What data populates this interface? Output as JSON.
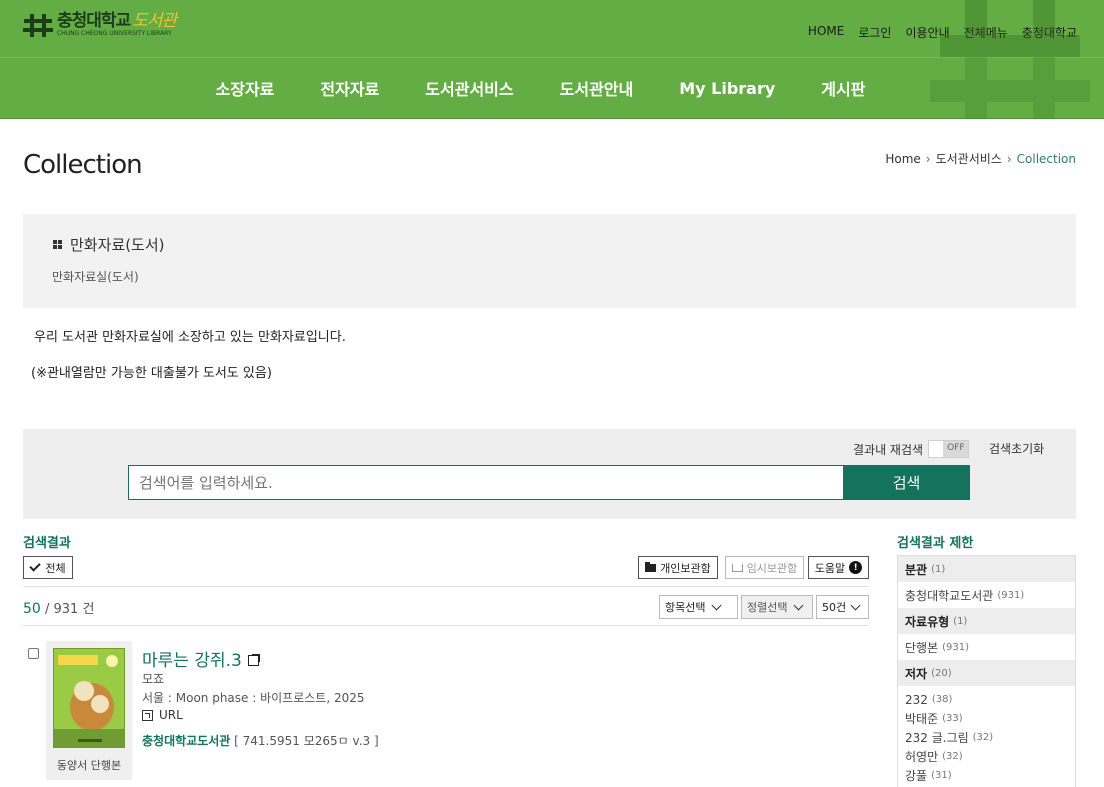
{
  "header": {
    "logo_kor": "충청대학교",
    "logo_lib": "도서관",
    "logo_eng": "CHUNG CHEONG UNIVERSITY LIBRARY",
    "util_links": [
      "HOME",
      "로그인",
      "이용안내",
      "전체메뉴",
      "충청대학교"
    ],
    "gnb": [
      "소장자료",
      "전자자료",
      "도서관서비스",
      "도서관안내",
      "My Library",
      "게시판"
    ]
  },
  "page": {
    "title": "Collection",
    "breadcrumb": [
      "Home",
      "도서관서비스",
      "Collection"
    ]
  },
  "info": {
    "title": "만화자료(도서)",
    "subtitle": "만화자료실(도서)",
    "desc1": "우리 도서관 만화자료실에 소장하고 있는 만화자료입니다.",
    "desc2": "(※관내열람만 가능한 대출불가 도서도 있음)"
  },
  "search": {
    "re_search_label": "결과내 재검색",
    "toggle_label": "OFF",
    "reset_label": "검색초기화",
    "placeholder": "검색어를 입력하세요.",
    "button": "검색"
  },
  "results": {
    "label": "검색결과",
    "all_button": "전체",
    "personal_button": "개인보관함",
    "temp_button": "임시보관함",
    "help_button": "도움말",
    "help_mark": "!",
    "count_shown": "50",
    "count_sep": "/",
    "count_total": "931 건",
    "select_items": "항목선택",
    "select_sort": "정렬선택",
    "select_per_page": "50건"
  },
  "items": [
    {
      "title": "마루는 강쥐.3",
      "author": "모죠",
      "publication": "서울 : Moon phase : 바이프로스트, 2025",
      "url_label": "URL",
      "library": "충청대학교도서관",
      "call_number": "[ 741.5951 모265ㅁ v.3 ]",
      "type": "동양서 단행본"
    }
  ],
  "facets": {
    "title": "검색결과 제한",
    "groups": [
      {
        "name": "분관",
        "count": "(1)",
        "values": [
          {
            "label": "충청대학교도서관",
            "count": "(931)"
          }
        ]
      },
      {
        "name": "자료유형",
        "count": "(1)",
        "values": [
          {
            "label": "단행본",
            "count": "(931)"
          }
        ]
      },
      {
        "name": "저자",
        "count": "(20)",
        "values": [
          {
            "label": "232",
            "count": "(38)"
          },
          {
            "label": "박태준",
            "count": "(33)"
          },
          {
            "label": "232 글.그림",
            "count": "(32)"
          },
          {
            "label": "허영만",
            "count": "(32)"
          },
          {
            "label": "강풀",
            "count": "(31)"
          }
        ]
      }
    ]
  },
  "colors": {
    "header_green": "#63ad44",
    "accent_teal": "#14735d"
  }
}
